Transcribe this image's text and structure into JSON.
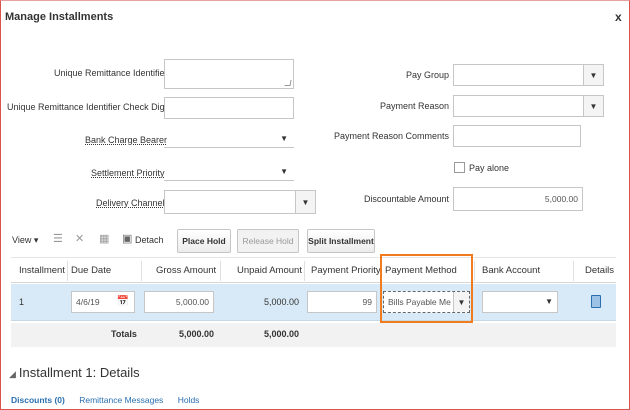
{
  "dialog": {
    "title": "Manage Installments",
    "close_label": "x"
  },
  "left_form": {
    "unique_remittance_identifier_label": "Unique Remittance Identifier",
    "unique_remittance_identifier_value": "",
    "check_digit_label": "Unique Remittance Identifier Check Digit",
    "check_digit_value": "",
    "bank_charge_bearer_label": "Bank Charge Bearer",
    "bank_charge_bearer_value": "",
    "settlement_priority_label": "Settlement Priority",
    "settlement_priority_value": "",
    "delivery_channel_label": "Delivery Channel",
    "delivery_channel_value": ""
  },
  "right_form": {
    "pay_group_label": "Pay Group",
    "pay_group_value": "",
    "payment_reason_label": "Payment Reason",
    "payment_reason_value": "",
    "payment_reason_comments_label": "Payment Reason Comments",
    "payment_reason_comments_value": "",
    "pay_alone_label": "Pay alone",
    "pay_alone_checked": false,
    "discountable_amount_label": "Discountable Amount",
    "discountable_amount_value": "5,000.00"
  },
  "toolbar": {
    "view_label": "View ▾",
    "detach_label": "Detach",
    "place_hold_label": "Place Hold",
    "release_hold_label": "Release Hold",
    "split_installment_label": "Split Installment",
    "icons": [
      "format-icon",
      "delete-icon",
      "freeze-icon",
      "detach-icon"
    ]
  },
  "table": {
    "headers": [
      "Installment",
      "Due Date",
      "Gross Amount",
      "Unpaid Amount",
      "Payment Priority",
      "Payment Method",
      "Bank Account",
      "Details"
    ],
    "row": {
      "installment": "1",
      "due_date": "4/6/19",
      "gross_amount": "5,000.00",
      "unpaid_amount": "5,000.00",
      "payment_priority": "99",
      "payment_method": "Bills Payable Me",
      "bank_account": ""
    },
    "totals": {
      "label": "Totals",
      "gross": "5,000.00",
      "unpaid": "5,000.00"
    }
  },
  "details_section": {
    "title": "Installment 1: Details",
    "links": [
      "Discounts (0)",
      "Remittance Messages",
      "Holds"
    ]
  },
  "colors": {
    "highlight": "#f07c1f",
    "selected_row": "#d8eaf7",
    "link": "#2a6fb0"
  }
}
